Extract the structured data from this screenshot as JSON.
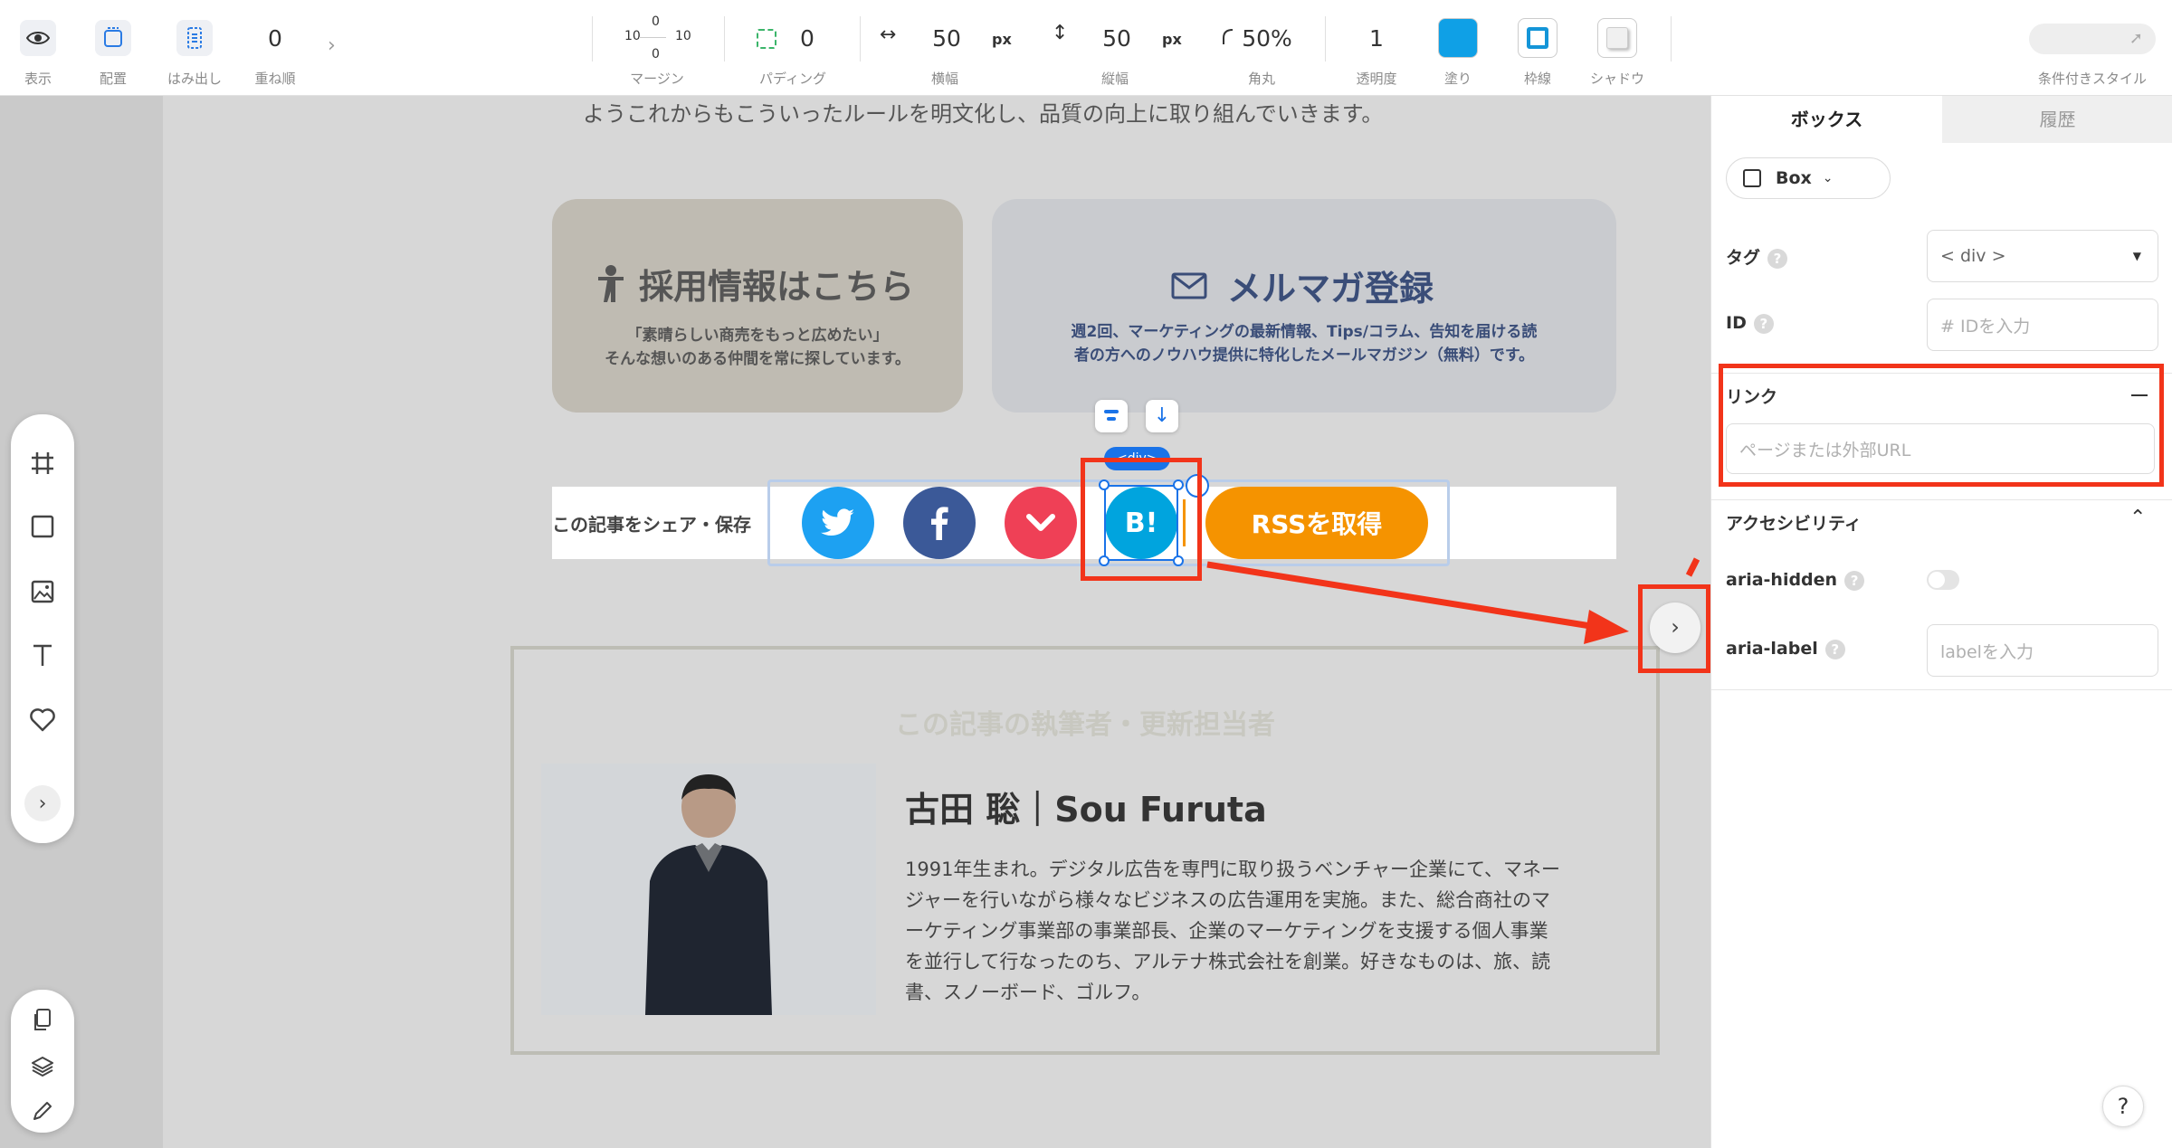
{
  "toolbar": {
    "view_label": "表示",
    "layout_label": "配置",
    "overflow_label": "はみ出し",
    "zindex_value": "0",
    "zindex_label": "重ね順",
    "margin": {
      "top": "0",
      "left": "10",
      "right": "10",
      "bottom": "0",
      "label": "マージン"
    },
    "padding": {
      "value": "0",
      "label": "パディング"
    },
    "width": {
      "value": "50",
      "unit": "px",
      "label": "横幅"
    },
    "height": {
      "value": "50",
      "unit": "px",
      "label": "縦幅"
    },
    "radius": {
      "value": "50%",
      "label": "角丸"
    },
    "opacity": {
      "value": "1",
      "label": "透明度"
    },
    "fill_label": "塗り",
    "border_label": "枠線",
    "shadow_label": "シャドウ",
    "conditional_label": "条件付きスタイル",
    "colors": {
      "fill": "#0fa0e6",
      "border": "#1495d8"
    }
  },
  "page": {
    "intro_text": "ようこれからもこういったルールを明文化し、品質の向上に取り組んでいきます。",
    "recruit": {
      "title": "採用情報はこちら",
      "line1": "「素晴らしい商売をもっと広めたい」",
      "line2": "そんな想いのある仲間を常に探しています。"
    },
    "newsletter": {
      "title": "メルマガ登録",
      "line1": "週2回、マーケティングの最新情報、Tips/コラム、告知を届ける読",
      "line2": "者の方へのノウハウ提供に特化したメールマガジン（無料）です。"
    },
    "share": {
      "label": "この記事をシェア・保存",
      "selected_tag": "<div>",
      "buttons": [
        {
          "name": "twitter",
          "color": "#1da1f2"
        },
        {
          "name": "facebook",
          "color": "#3b5998"
        },
        {
          "name": "pocket",
          "color": "#ef4056"
        },
        {
          "name": "hatena",
          "color": "#00a4de",
          "glyph": "B!"
        }
      ],
      "rss_label": "RSSを取得",
      "rss_color": "#f59300"
    },
    "author": {
      "heading": "この記事の執筆者・更新担当者",
      "name": "古田 聡｜Sou Furuta",
      "bio": [
        "1991年生まれ。デジタル広告を専門に取り扱うベンチャー企業にて、マネー",
        "ジャーを行いながら様々なビジネスの広告運用を実施。また、総合商社のマ",
        "ーケティング事業部の事業部長、企業のマーケティングを支援する個人事業",
        "を並行して行なったのち、アルテナ株式会社を創業。好きなものは、旅、読",
        "書、スノーボード、ゴルフ。"
      ]
    }
  },
  "panel": {
    "tabs": [
      "ボックス",
      "履歴"
    ],
    "element_type": "Box",
    "tag_label": "タグ",
    "tag_value": "< div >",
    "id_label": "ID",
    "id_placeholder": "# IDを入力",
    "link_label": "リンク",
    "link_placeholder": "ページまたは外部URL",
    "accessibility_label": "アクセシビリティ",
    "aria_hidden_label": "aria-hidden",
    "aria_label_label": "aria-label",
    "aria_label_placeholder": "labelを入力",
    "help_button": "?"
  }
}
